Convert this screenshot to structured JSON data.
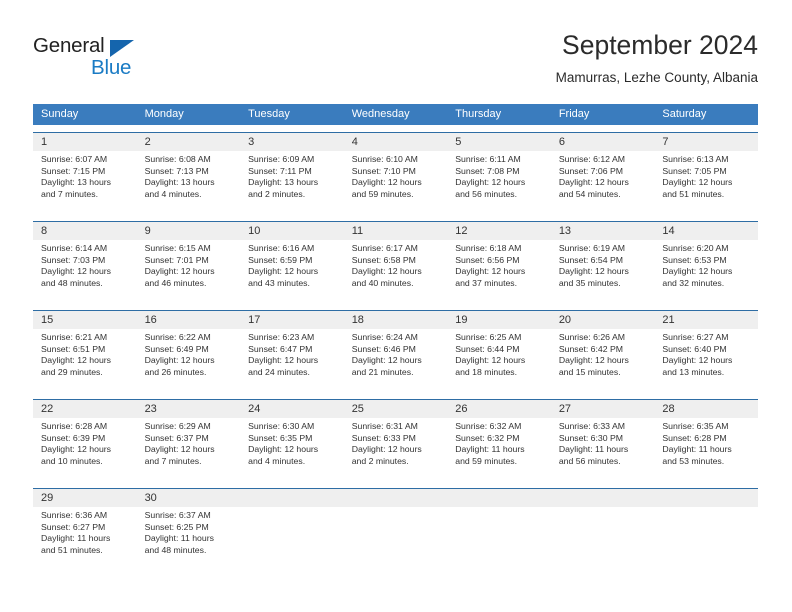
{
  "brand": {
    "word_one": "General",
    "word_two": "Blue",
    "accent_dark": "#1565ad",
    "accent_light": "#1a7bc4"
  },
  "header": {
    "title": "September 2024",
    "subtitle": "Mamurras, Lezhe County, Albania"
  },
  "theme": {
    "header_blue": "#3a7cbe",
    "rule_blue": "#2e6da4",
    "date_band": "#efefef"
  },
  "weekdays": [
    "Sunday",
    "Monday",
    "Tuesday",
    "Wednesday",
    "Thursday",
    "Friday",
    "Saturday"
  ],
  "weeks": [
    {
      "days": [
        {
          "date": "1",
          "sunrise": "Sunrise: 6:07 AM",
          "sunset": "Sunset: 7:15 PM",
          "daylight_1": "Daylight: 13 hours",
          "daylight_2": "and 7 minutes."
        },
        {
          "date": "2",
          "sunrise": "Sunrise: 6:08 AM",
          "sunset": "Sunset: 7:13 PM",
          "daylight_1": "Daylight: 13 hours",
          "daylight_2": "and 4 minutes."
        },
        {
          "date": "3",
          "sunrise": "Sunrise: 6:09 AM",
          "sunset": "Sunset: 7:11 PM",
          "daylight_1": "Daylight: 13 hours",
          "daylight_2": "and 2 minutes."
        },
        {
          "date": "4",
          "sunrise": "Sunrise: 6:10 AM",
          "sunset": "Sunset: 7:10 PM",
          "daylight_1": "Daylight: 12 hours",
          "daylight_2": "and 59 minutes."
        },
        {
          "date": "5",
          "sunrise": "Sunrise: 6:11 AM",
          "sunset": "Sunset: 7:08 PM",
          "daylight_1": "Daylight: 12 hours",
          "daylight_2": "and 56 minutes."
        },
        {
          "date": "6",
          "sunrise": "Sunrise: 6:12 AM",
          "sunset": "Sunset: 7:06 PM",
          "daylight_1": "Daylight: 12 hours",
          "daylight_2": "and 54 minutes."
        },
        {
          "date": "7",
          "sunrise": "Sunrise: 6:13 AM",
          "sunset": "Sunset: 7:05 PM",
          "daylight_1": "Daylight: 12 hours",
          "daylight_2": "and 51 minutes."
        }
      ]
    },
    {
      "days": [
        {
          "date": "8",
          "sunrise": "Sunrise: 6:14 AM",
          "sunset": "Sunset: 7:03 PM",
          "daylight_1": "Daylight: 12 hours",
          "daylight_2": "and 48 minutes."
        },
        {
          "date": "9",
          "sunrise": "Sunrise: 6:15 AM",
          "sunset": "Sunset: 7:01 PM",
          "daylight_1": "Daylight: 12 hours",
          "daylight_2": "and 46 minutes."
        },
        {
          "date": "10",
          "sunrise": "Sunrise: 6:16 AM",
          "sunset": "Sunset: 6:59 PM",
          "daylight_1": "Daylight: 12 hours",
          "daylight_2": "and 43 minutes."
        },
        {
          "date": "11",
          "sunrise": "Sunrise: 6:17 AM",
          "sunset": "Sunset: 6:58 PM",
          "daylight_1": "Daylight: 12 hours",
          "daylight_2": "and 40 minutes."
        },
        {
          "date": "12",
          "sunrise": "Sunrise: 6:18 AM",
          "sunset": "Sunset: 6:56 PM",
          "daylight_1": "Daylight: 12 hours",
          "daylight_2": "and 37 minutes."
        },
        {
          "date": "13",
          "sunrise": "Sunrise: 6:19 AM",
          "sunset": "Sunset: 6:54 PM",
          "daylight_1": "Daylight: 12 hours",
          "daylight_2": "and 35 minutes."
        },
        {
          "date": "14",
          "sunrise": "Sunrise: 6:20 AM",
          "sunset": "Sunset: 6:53 PM",
          "daylight_1": "Daylight: 12 hours",
          "daylight_2": "and 32 minutes."
        }
      ]
    },
    {
      "days": [
        {
          "date": "15",
          "sunrise": "Sunrise: 6:21 AM",
          "sunset": "Sunset: 6:51 PM",
          "daylight_1": "Daylight: 12 hours",
          "daylight_2": "and 29 minutes."
        },
        {
          "date": "16",
          "sunrise": "Sunrise: 6:22 AM",
          "sunset": "Sunset: 6:49 PM",
          "daylight_1": "Daylight: 12 hours",
          "daylight_2": "and 26 minutes."
        },
        {
          "date": "17",
          "sunrise": "Sunrise: 6:23 AM",
          "sunset": "Sunset: 6:47 PM",
          "daylight_1": "Daylight: 12 hours",
          "daylight_2": "and 24 minutes."
        },
        {
          "date": "18",
          "sunrise": "Sunrise: 6:24 AM",
          "sunset": "Sunset: 6:46 PM",
          "daylight_1": "Daylight: 12 hours",
          "daylight_2": "and 21 minutes."
        },
        {
          "date": "19",
          "sunrise": "Sunrise: 6:25 AM",
          "sunset": "Sunset: 6:44 PM",
          "daylight_1": "Daylight: 12 hours",
          "daylight_2": "and 18 minutes."
        },
        {
          "date": "20",
          "sunrise": "Sunrise: 6:26 AM",
          "sunset": "Sunset: 6:42 PM",
          "daylight_1": "Daylight: 12 hours",
          "daylight_2": "and 15 minutes."
        },
        {
          "date": "21",
          "sunrise": "Sunrise: 6:27 AM",
          "sunset": "Sunset: 6:40 PM",
          "daylight_1": "Daylight: 12 hours",
          "daylight_2": "and 13 minutes."
        }
      ]
    },
    {
      "days": [
        {
          "date": "22",
          "sunrise": "Sunrise: 6:28 AM",
          "sunset": "Sunset: 6:39 PM",
          "daylight_1": "Daylight: 12 hours",
          "daylight_2": "and 10 minutes."
        },
        {
          "date": "23",
          "sunrise": "Sunrise: 6:29 AM",
          "sunset": "Sunset: 6:37 PM",
          "daylight_1": "Daylight: 12 hours",
          "daylight_2": "and 7 minutes."
        },
        {
          "date": "24",
          "sunrise": "Sunrise: 6:30 AM",
          "sunset": "Sunset: 6:35 PM",
          "daylight_1": "Daylight: 12 hours",
          "daylight_2": "and 4 minutes."
        },
        {
          "date": "25",
          "sunrise": "Sunrise: 6:31 AM",
          "sunset": "Sunset: 6:33 PM",
          "daylight_1": "Daylight: 12 hours",
          "daylight_2": "and 2 minutes."
        },
        {
          "date": "26",
          "sunrise": "Sunrise: 6:32 AM",
          "sunset": "Sunset: 6:32 PM",
          "daylight_1": "Daylight: 11 hours",
          "daylight_2": "and 59 minutes."
        },
        {
          "date": "27",
          "sunrise": "Sunrise: 6:33 AM",
          "sunset": "Sunset: 6:30 PM",
          "daylight_1": "Daylight: 11 hours",
          "daylight_2": "and 56 minutes."
        },
        {
          "date": "28",
          "sunrise": "Sunrise: 6:35 AM",
          "sunset": "Sunset: 6:28 PM",
          "daylight_1": "Daylight: 11 hours",
          "daylight_2": "and 53 minutes."
        }
      ]
    },
    {
      "days": [
        {
          "date": "29",
          "sunrise": "Sunrise: 6:36 AM",
          "sunset": "Sunset: 6:27 PM",
          "daylight_1": "Daylight: 11 hours",
          "daylight_2": "and 51 minutes."
        },
        {
          "date": "30",
          "sunrise": "Sunrise: 6:37 AM",
          "sunset": "Sunset: 6:25 PM",
          "daylight_1": "Daylight: 11 hours",
          "daylight_2": "and 48 minutes."
        },
        {
          "date": "",
          "sunrise": "",
          "sunset": "",
          "daylight_1": "",
          "daylight_2": ""
        },
        {
          "date": "",
          "sunrise": "",
          "sunset": "",
          "daylight_1": "",
          "daylight_2": ""
        },
        {
          "date": "",
          "sunrise": "",
          "sunset": "",
          "daylight_1": "",
          "daylight_2": ""
        },
        {
          "date": "",
          "sunrise": "",
          "sunset": "",
          "daylight_1": "",
          "daylight_2": ""
        },
        {
          "date": "",
          "sunrise": "",
          "sunset": "",
          "daylight_1": "",
          "daylight_2": ""
        }
      ]
    }
  ]
}
